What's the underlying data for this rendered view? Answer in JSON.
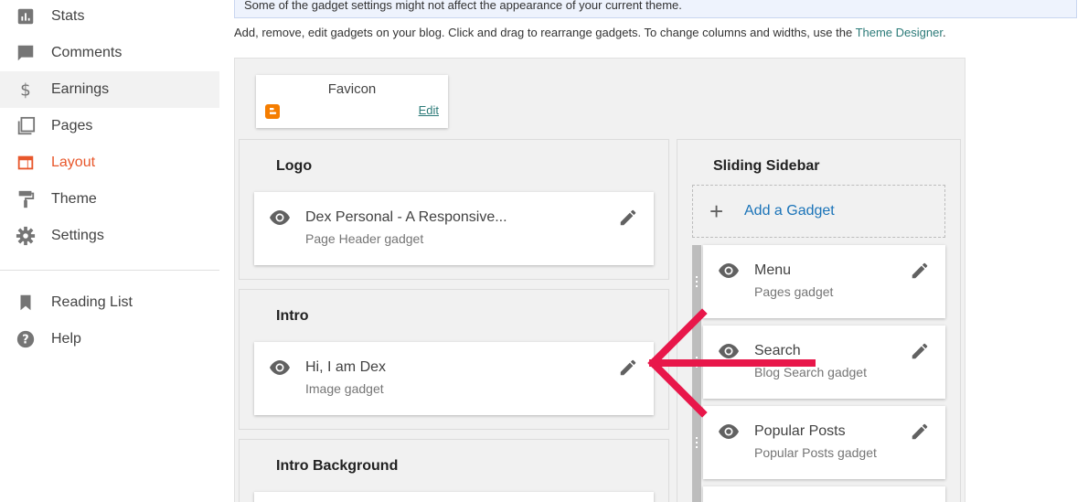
{
  "nav": {
    "items": [
      {
        "label": "Stats",
        "icon": "bar-chart-icon"
      },
      {
        "label": "Comments",
        "icon": "comment-icon"
      },
      {
        "label": "Earnings",
        "icon": "dollar-icon"
      },
      {
        "label": "Pages",
        "icon": "pages-icon"
      },
      {
        "label": "Layout",
        "icon": "layout-icon"
      },
      {
        "label": "Theme",
        "icon": "paint-roller-icon"
      },
      {
        "label": "Settings",
        "icon": "gear-icon"
      },
      {
        "label": "Reading List",
        "icon": "bookmark-icon"
      },
      {
        "label": "Help",
        "icon": "help-icon"
      }
    ],
    "current": "Layout"
  },
  "notice": {
    "text": "Some of the gadget settings might not affect the appearance of your current theme."
  },
  "info": {
    "text": "Add, remove, edit gadgets on your blog. Click and drag to rearrange gadgets. To change columns and widths, use the ",
    "link": "Theme Designer",
    "suffix": "."
  },
  "favicon": {
    "title": "Favicon",
    "edit": "Edit"
  },
  "sections": {
    "logo": {
      "title": "Logo",
      "gadget": {
        "name": "Dex Personal - A Responsive...",
        "type": "Page Header gadget"
      }
    },
    "intro": {
      "title": "Intro",
      "gadget": {
        "name": "Hi, I am Dex",
        "type": "Image gadget"
      }
    },
    "intro_background": {
      "title": "Intro Background"
    },
    "sliding_sidebar": {
      "title": "Sliding Sidebar",
      "add_label": "Add a Gadget",
      "gadgets": [
        {
          "name": "Menu",
          "type": "Pages gadget"
        },
        {
          "name": "Search",
          "type": "Blog Search gadget"
        },
        {
          "name": "Popular Posts",
          "type": "Popular Posts gadget"
        }
      ]
    }
  },
  "colors": {
    "accent_active": "#e8572b",
    "link": "#2b7a78",
    "add_gadget": "#1a73b8",
    "arrow": "#e8174a",
    "blogger": "#f57d00"
  }
}
